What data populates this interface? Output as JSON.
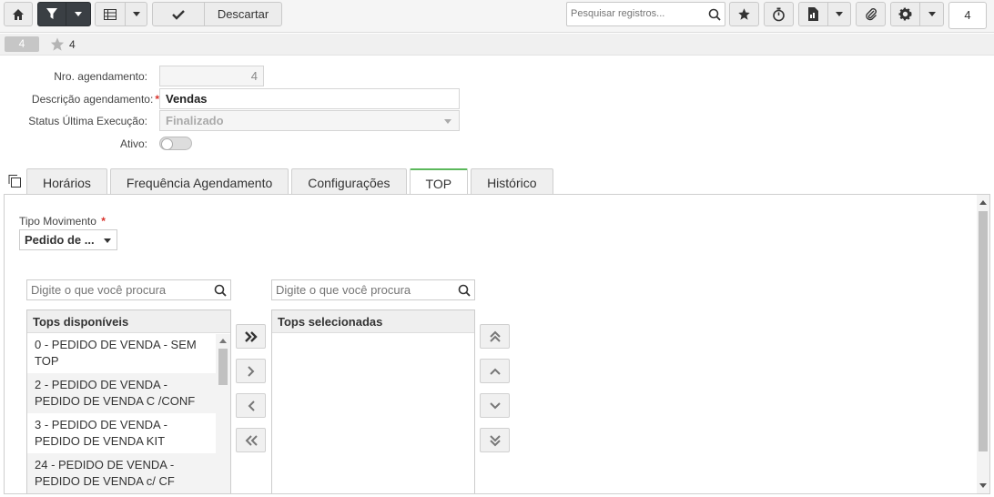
{
  "toolbar": {
    "discard_label": "Descartar",
    "search_placeholder": "Pesquisar registros...",
    "record_count": "4",
    "icons": [
      "home-icon",
      "filter-icon",
      "grid-icon",
      "check-icon",
      "search-icon",
      "star-icon",
      "stopwatch-icon",
      "report-icon",
      "paperclip-icon",
      "gear-icon"
    ]
  },
  "recordbar": {
    "badge": "4",
    "star_count": "4"
  },
  "form": {
    "nro_label": "Nro. agendamento:",
    "nro_value": "4",
    "descricao_label": "Descrição agendamento:",
    "descricao_value": "Vendas",
    "status_label": "Status Última Execução:",
    "status_value": "Finalizado",
    "ativo_label": "Ativo:",
    "ativo_value": false
  },
  "tabs": [
    {
      "label": "Horários"
    },
    {
      "label": "Frequência Agendamento"
    },
    {
      "label": "Configurações"
    },
    {
      "label": "TOP",
      "active": true
    },
    {
      "label": "Histórico"
    }
  ],
  "top_panel": {
    "tipo_label": "Tipo Movimento",
    "tipo_value": "Pedido de ...",
    "search_available_placeholder": "Digite o que você procura",
    "search_selected_placeholder": "Digite o que você procura",
    "available_header": "Tops disponíveis",
    "selected_header": "Tops selecionadas",
    "available_items": [
      {
        "line1": "0 - PEDIDO DE VENDA - SEM",
        "line2": "TOP"
      },
      {
        "line1": "2 - PEDIDO DE VENDA -",
        "line2": "PEDIDO DE VENDA C /CONF"
      },
      {
        "line1": "3 - PEDIDO DE VENDA -",
        "line2": "PEDIDO DE VENDA KIT"
      },
      {
        "line1": "24 - PEDIDO DE VENDA -",
        "line2": "PEDIDO DE VENDA c/ CF"
      }
    ],
    "selected_items": []
  }
}
